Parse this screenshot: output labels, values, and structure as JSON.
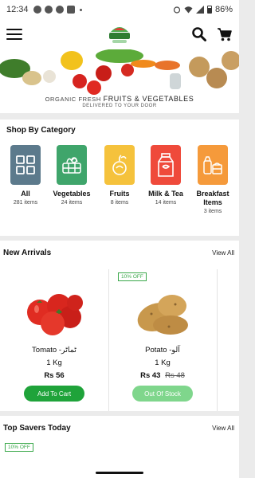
{
  "status_bar": {
    "time": "12:34",
    "battery": "86%"
  },
  "banner": {
    "line1_prefix": "ORGANIC FRESH",
    "line1_highlight": "FRUITS & VEGETABLES",
    "line2": "DELIVERED TO YOUR DOOR"
  },
  "categories": {
    "title": "Shop By Category",
    "items": [
      {
        "name": "All",
        "count": "281 items",
        "color": "#5c7a8c"
      },
      {
        "name": "Vegetables",
        "count": "24 items",
        "color": "#3fa56b"
      },
      {
        "name": "Fruits",
        "count": "8 items",
        "color": "#f5c23c"
      },
      {
        "name": "Milk & Tea",
        "count": "14 items",
        "color": "#ef4a3b"
      },
      {
        "name": "Breakfast Items",
        "count": "3 items",
        "color": "#f59a3b"
      }
    ]
  },
  "arrivals": {
    "title": "New Arrivals",
    "view_all": "View All",
    "products": [
      {
        "name": "Tomato -ٹماٹر",
        "qty": "1 Kg",
        "price": "Rs 56",
        "old_price": "",
        "button": "Add To Cart",
        "badge": ""
      },
      {
        "name": "Potato -آلو",
        "qty": "1 Kg",
        "price": "Rs 43",
        "old_price": "Rs 48",
        "button": "Out Of Stock",
        "badge": "10% OFF"
      }
    ]
  },
  "savers": {
    "title": "Top Savers Today",
    "view_all": "View All",
    "badge": "10% OFF"
  },
  "colors": {
    "accent": "#1fa33a",
    "accent_disabled": "#7fd68c"
  }
}
